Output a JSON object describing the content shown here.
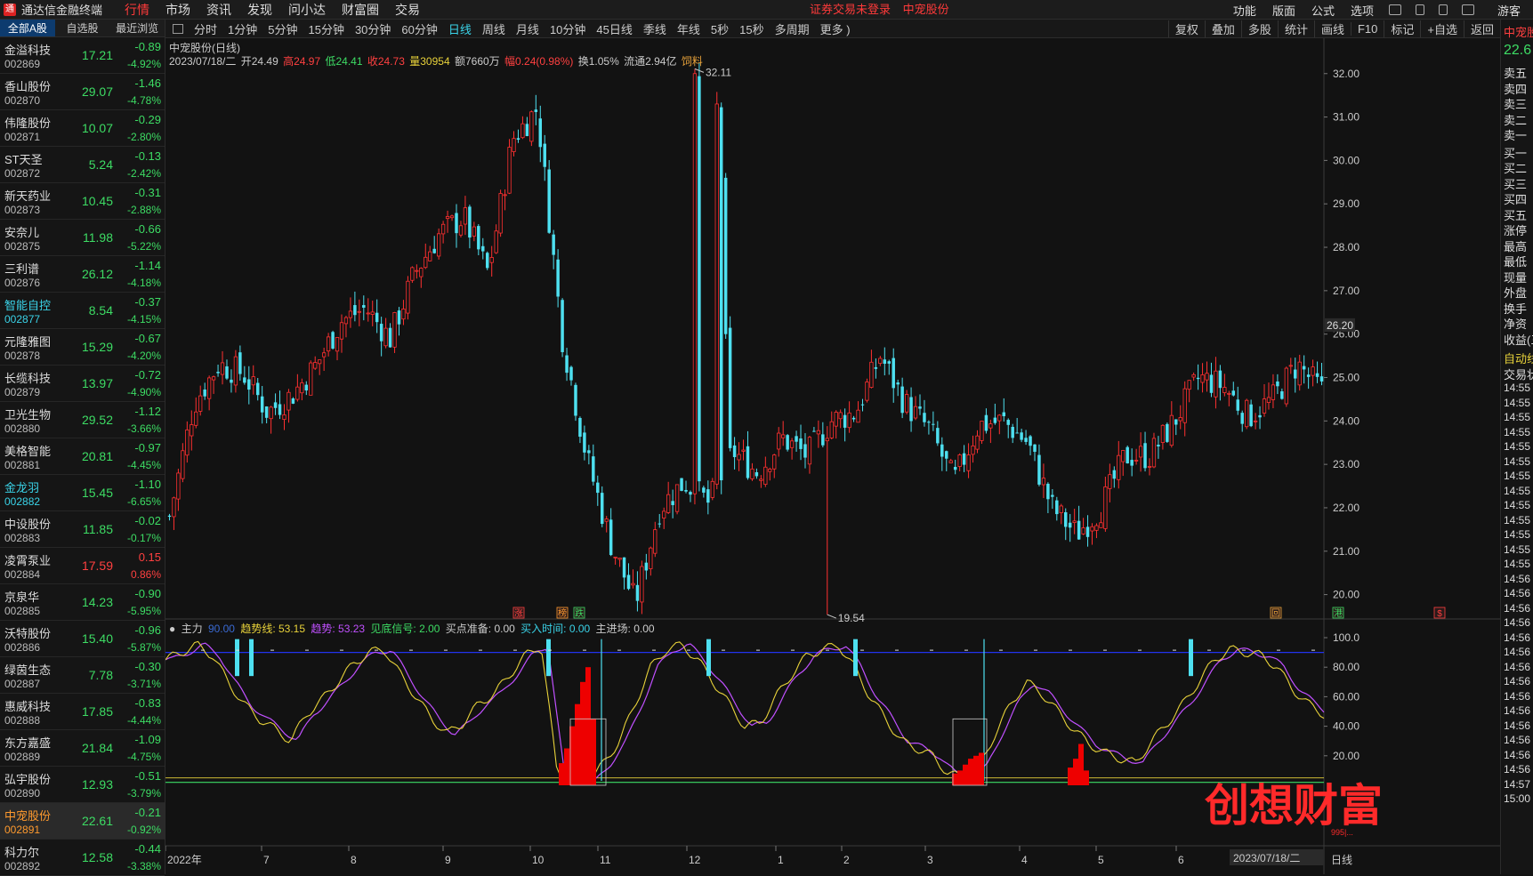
{
  "app": {
    "title": "通达信金融终端",
    "logo": "通"
  },
  "menu": [
    "行情",
    "市场",
    "资讯",
    "发现",
    "问小达",
    "财富圈",
    "交易"
  ],
  "notice": [
    "证券交易未登录",
    "中宠股份"
  ],
  "right_menu": [
    "功能",
    "版面",
    "公式",
    "选项",
    "游客"
  ],
  "left_tabs": [
    "全部A股",
    "自选股",
    "最近浏览"
  ],
  "stocks": [
    {
      "name": "金溢科技",
      "code": "002869",
      "price": "17.21",
      "chg": "-0.89",
      "pct": "-4.92%",
      "color": "g",
      "name_color": ""
    },
    {
      "name": "香山股份",
      "code": "002870",
      "price": "29.07",
      "chg": "-1.46",
      "pct": "-4.78%",
      "color": "g",
      "name_color": ""
    },
    {
      "name": "伟隆股份",
      "code": "002871",
      "price": "10.07",
      "chg": "-0.29",
      "pct": "-2.80%",
      "color": "g",
      "name_color": ""
    },
    {
      "name": "ST天圣",
      "code": "002872",
      "price": "5.24",
      "chg": "-0.13",
      "pct": "-2.42%",
      "color": "g",
      "name_color": ""
    },
    {
      "name": "新天药业",
      "code": "002873",
      "price": "10.45",
      "chg": "-0.31",
      "pct": "-2.88%",
      "color": "g",
      "name_color": ""
    },
    {
      "name": "安奈儿",
      "code": "002875",
      "price": "11.98",
      "chg": "-0.66",
      "pct": "-5.22%",
      "color": "g",
      "name_color": ""
    },
    {
      "name": "三利谱",
      "code": "002876",
      "price": "26.12",
      "chg": "-1.14",
      "pct": "-4.18%",
      "color": "g",
      "name_color": ""
    },
    {
      "name": "智能自控",
      "code": "002877",
      "price": "8.54",
      "chg": "-0.37",
      "pct": "-4.15%",
      "color": "g",
      "name_color": "c"
    },
    {
      "name": "元隆雅图",
      "code": "002878",
      "price": "15.29",
      "chg": "-0.67",
      "pct": "-4.20%",
      "color": "g",
      "name_color": ""
    },
    {
      "name": "长缆科技",
      "code": "002879",
      "price": "13.97",
      "chg": "-0.72",
      "pct": "-4.90%",
      "color": "g",
      "name_color": ""
    },
    {
      "name": "卫光生物",
      "code": "002880",
      "price": "29.52",
      "chg": "-1.12",
      "pct": "-3.66%",
      "color": "g",
      "name_color": ""
    },
    {
      "name": "美格智能",
      "code": "002881",
      "price": "20.81",
      "chg": "-0.97",
      "pct": "-4.45%",
      "color": "g",
      "name_color": ""
    },
    {
      "name": "金龙羽",
      "code": "002882",
      "price": "15.45",
      "chg": "-1.10",
      "pct": "-6.65%",
      "color": "g",
      "name_color": "c"
    },
    {
      "name": "中设股份",
      "code": "002883",
      "price": "11.85",
      "chg": "-0.02",
      "pct": "-0.17%",
      "color": "g",
      "name_color": ""
    },
    {
      "name": "凌霄泵业",
      "code": "002884",
      "price": "17.59",
      "chg": "0.15",
      "pct": "0.86%",
      "color": "r",
      "name_color": ""
    },
    {
      "name": "京泉华",
      "code": "002885",
      "price": "14.23",
      "chg": "-0.90",
      "pct": "-5.95%",
      "color": "g",
      "name_color": ""
    },
    {
      "name": "沃特股份",
      "code": "002886",
      "price": "15.40",
      "chg": "-0.96",
      "pct": "-5.87%",
      "color": "g",
      "name_color": ""
    },
    {
      "name": "绿茵生态",
      "code": "002887",
      "price": "7.78",
      "chg": "-0.30",
      "pct": "-3.71%",
      "color": "g",
      "name_color": ""
    },
    {
      "name": "惠威科技",
      "code": "002888",
      "price": "17.85",
      "chg": "-0.83",
      "pct": "-4.44%",
      "color": "g",
      "name_color": ""
    },
    {
      "name": "东方嘉盛",
      "code": "002889",
      "price": "21.84",
      "chg": "-1.09",
      "pct": "-4.75%",
      "color": "g",
      "name_color": ""
    },
    {
      "name": "弘宇股份",
      "code": "002890",
      "price": "12.93",
      "chg": "-0.51",
      "pct": "-3.79%",
      "color": "g",
      "name_color": ""
    },
    {
      "name": "中宠股份",
      "code": "002891",
      "price": "22.61",
      "chg": "-0.21",
      "pct": "-0.92%",
      "color": "g",
      "name_color": "o"
    },
    {
      "name": "科力尔",
      "code": "002892",
      "price": "12.58",
      "chg": "-0.44",
      "pct": "-3.38%",
      "color": "g",
      "name_color": ""
    }
  ],
  "periods": [
    "分时",
    "1分钟",
    "5分钟",
    "15分钟",
    "30分钟",
    "60分钟",
    "日线",
    "周线",
    "月线",
    "10分钟",
    "45日线",
    "季线",
    "年线",
    "5秒",
    "15秒",
    "多周期",
    "更多 )"
  ],
  "active_period": "日线",
  "tools": [
    "复权",
    "叠加",
    "多股",
    "统计",
    "画线",
    "F10",
    "标记",
    "+自选",
    "返回"
  ],
  "chart": {
    "title": "中宠股份(日线)",
    "date": "2023/07/18/二",
    "open": "开24.49",
    "high": "高24.97",
    "low": "低24.41",
    "close": "收24.73",
    "vol": "量30954",
    "amount": "额7660万",
    "change": "幅0.24(0.98%)",
    "turnover": "换1.05%",
    "float": "流通2.94亿",
    "industry": "饲料",
    "price_axis": [
      "32.00",
      "31.00",
      "30.00",
      "29.00",
      "28.00",
      "27.00",
      "26.00",
      "25.00",
      "24.00",
      "23.00",
      "22.00",
      "21.00",
      "20.00"
    ],
    "current_price_tag": "26.20",
    "high_label": "32.11",
    "low_label": "19.54",
    "x_labels": [
      "2022年",
      "7",
      "8",
      "9",
      "10",
      "11",
      "12",
      "1",
      "2",
      "3",
      "4",
      "5",
      "6",
      "2023/07/18/二"
    ],
    "axis_period_label": "日线",
    "markers": [
      "涨",
      "榜",
      "跌",
      "回",
      "港",
      "$"
    ]
  },
  "indicator": {
    "name": "主力",
    "value0": "90.00",
    "trend_line": "趋势线: 53.15",
    "trend": "趋势: 53.23",
    "bottom_signal": "见底信号: 2.00",
    "buy_prep": "买点准备: 0.00",
    "buy_time": "买入时间: 0.00",
    "main_entry": "主进场: 0.00",
    "axis": [
      "100.0",
      "80.00",
      "60.00",
      "40.00",
      "20.00"
    ]
  },
  "right_panel": {
    "stock": "中宠股份",
    "price": "22.6",
    "levels": [
      "卖五",
      "卖四",
      "卖三",
      "卖二",
      "卖一",
      "买一",
      "买二",
      "买三",
      "买四",
      "买五",
      "涨停",
      "最高",
      "最低",
      "现量",
      "外盘",
      "换手",
      "净资",
      "收益(三"
    ],
    "auto": "自动线",
    "status": "交易状",
    "times": [
      "14:55",
      "14:55",
      "14:55",
      "14:55",
      "14:55",
      "14:55",
      "14:55",
      "14:55",
      "14:55",
      "14:55",
      "14:55",
      "14:55",
      "14:55",
      "14:56",
      "14:56",
      "14:56",
      "14:56",
      "14:56",
      "14:56",
      "14:56",
      "14:56",
      "14:56",
      "14:56",
      "14:56",
      "14:56",
      "14:56",
      "14:56",
      "14:57",
      "15:00"
    ]
  },
  "watermark": {
    "text": "创想财富",
    "sub": "995|..."
  },
  "colors": {
    "up": "#ff4040",
    "down": "#3ad3e8",
    "green": "#3ddc64",
    "accent_blue": "#0d3b6e",
    "yellow": "#e8d23a",
    "purple": "#c050ff"
  },
  "chart_data": {
    "type": "candlestick",
    "x": [
      "2022年",
      "7",
      "8",
      "9",
      "10",
      "11",
      "12",
      "1",
      "2",
      "3",
      "4",
      "5",
      "6"
    ],
    "y_range": [
      19.5,
      32.2
    ],
    "approx_close_path": [
      21.8,
      24.4,
      25.3,
      25.1,
      24.2,
      24.6,
      25.3,
      26.3,
      26.6,
      25.9,
      27.4,
      28.3,
      28.7,
      27.4,
      30.5,
      31.2,
      26.0,
      23.2,
      21.2,
      19.8,
      22.0,
      22.6,
      22.1,
      23.3,
      22.8,
      23.6,
      23.2,
      24.0,
      24.2,
      25.5,
      24.4,
      23.8,
      22.6,
      23.9,
      24.0,
      23.5,
      22.0,
      21.4,
      22.0,
      23.2,
      23.2,
      24.0,
      25.0,
      24.8,
      24.1,
      24.5,
      25.3,
      24.7
    ],
    "high": 32.11,
    "low": 19.54
  }
}
